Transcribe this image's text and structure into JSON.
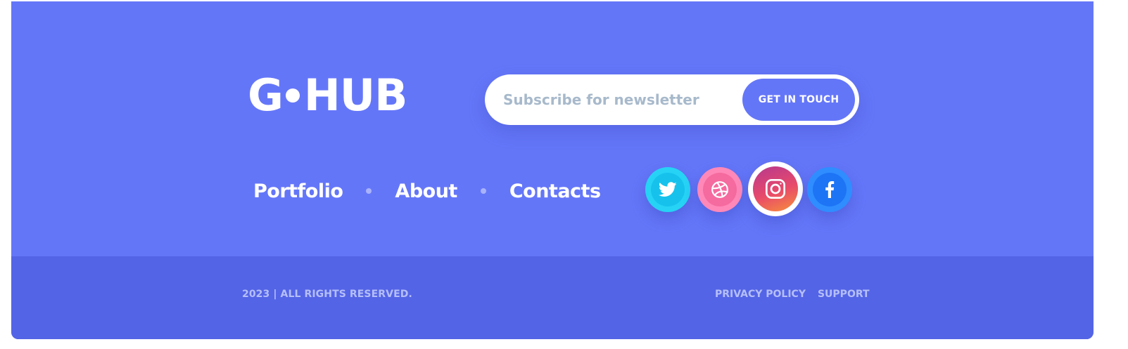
{
  "brand": {
    "logo_left": "G",
    "logo_right": "HUB"
  },
  "newsletter": {
    "placeholder": "Subscribe for newsletter",
    "button_label": "GET IN TOUCH"
  },
  "nav": {
    "items": [
      "Portfolio",
      "About",
      "Contacts"
    ]
  },
  "social": {
    "icons": [
      "twitter-icon",
      "dribbble-icon",
      "instagram-icon",
      "facebook-icon"
    ]
  },
  "footer_bottom": {
    "copyright": "2023  |  ALL RIGHTS RESERVED.",
    "links": [
      "PRIVACY POLICY",
      "SUPPORT"
    ]
  },
  "colors": {
    "background": "#6476f8",
    "bottom_bar": "#5464e6",
    "text": "#ffffff",
    "muted_text": "#b5bff9",
    "input_placeholder": "#a7b9cb",
    "twitter": "#16c2ec",
    "dribbble": "#f56a9f",
    "instagram_gradient": [
      "#b6388f",
      "#f7903a"
    ],
    "facebook": "#1d74f5"
  }
}
